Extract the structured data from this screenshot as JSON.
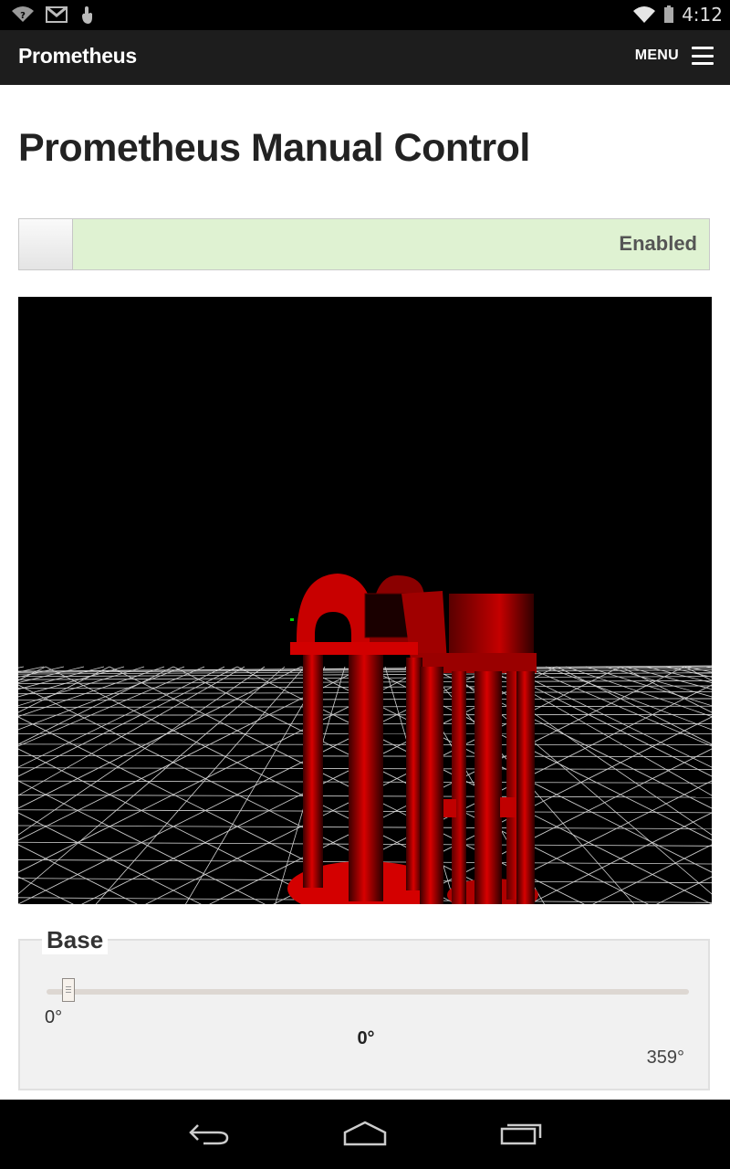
{
  "status_bar": {
    "time": "4:12",
    "icons": [
      "wifi-question-icon",
      "gmail-icon",
      "touch-icon",
      "wifi-icon",
      "battery-icon"
    ]
  },
  "header": {
    "brand": "Prometheus",
    "menu_label": "MENU"
  },
  "main": {
    "title": "Prometheus Manual Control",
    "toggle": {
      "state_label": "Enabled",
      "enabled": true
    }
  },
  "controls": {
    "base": {
      "legend": "Base",
      "min_label": "0°",
      "max_label": "359°",
      "current_label": "0°",
      "value": 0,
      "min": 0,
      "max": 359
    }
  },
  "nav": {
    "icons": [
      "back-icon",
      "home-icon",
      "recent-apps-icon"
    ]
  },
  "colors": {
    "toggle_bg": "#dff2d2",
    "header_bg": "#1d1d1d",
    "robot": "#d40000"
  }
}
